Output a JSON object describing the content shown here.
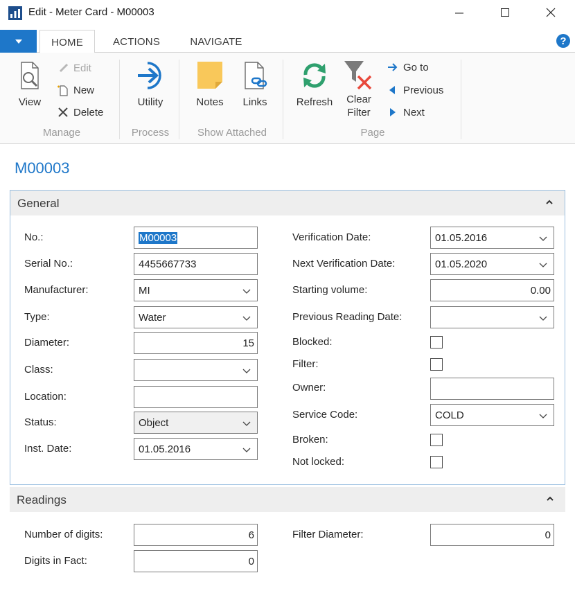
{
  "window": {
    "title": "Edit - Meter Card - M00003"
  },
  "tabs": [
    {
      "label": "HOME"
    },
    {
      "label": "ACTIONS"
    },
    {
      "label": "NAVIGATE"
    }
  ],
  "help": {
    "label": "?"
  },
  "ribbon": {
    "manage": {
      "group": "Manage",
      "view": "View",
      "edit": "Edit",
      "new": "New",
      "delete": "Delete"
    },
    "process": {
      "group": "Process",
      "utility": "Utility"
    },
    "attached": {
      "group": "Show Attached",
      "notes": "Notes",
      "links": "Links"
    },
    "page": {
      "group": "Page",
      "refresh": "Refresh",
      "clear_filter_1": "Clear",
      "clear_filter_2": "Filter",
      "goto": "Go to",
      "previous": "Previous",
      "next": "Next"
    }
  },
  "record": {
    "title": "M00003"
  },
  "general": {
    "title": "General",
    "left": [
      {
        "label": "No.:",
        "value": "M00003"
      },
      {
        "label": "Serial No.:",
        "value": "4455667733"
      },
      {
        "label": "Manufacturer:",
        "value": "MI"
      },
      {
        "label": "Type:",
        "value": "Water"
      },
      {
        "label": "Diameter:",
        "value": "15"
      },
      {
        "label": "Class:",
        "value": ""
      },
      {
        "label": "Location:",
        "value": ""
      },
      {
        "label": "Status:",
        "value": "Object"
      },
      {
        "label": "Inst. Date:",
        "value": "01.05.2016"
      }
    ],
    "right": [
      {
        "label": "Verification Date:",
        "value": "01.05.2016"
      },
      {
        "label": "Next Verification Date:",
        "value": "01.05.2020"
      },
      {
        "label": "Starting volume:",
        "value": "0.00"
      },
      {
        "label": "Previous Reading Date:",
        "value": ""
      },
      {
        "label": "Blocked:",
        "checked": false
      },
      {
        "label": "Filter:",
        "checked": false
      },
      {
        "label": "Owner:",
        "value": ""
      },
      {
        "label": "Service Code:",
        "value": "COLD"
      },
      {
        "label": "Broken:",
        "checked": false
      },
      {
        "label": "Not locked:",
        "checked": false
      }
    ]
  },
  "readings": {
    "title": "Readings",
    "number_of_digits": {
      "label": "Number of digits:",
      "value": "6"
    },
    "digits_in_fact": {
      "label": "Digits in Fact:",
      "value": "0"
    },
    "filter_diameter": {
      "label": "Filter Diameter:",
      "value": "0"
    }
  },
  "colors": {
    "accent": "#1e77c9",
    "section_border": "#9bbfe0",
    "section_header": "#eeeeee"
  }
}
